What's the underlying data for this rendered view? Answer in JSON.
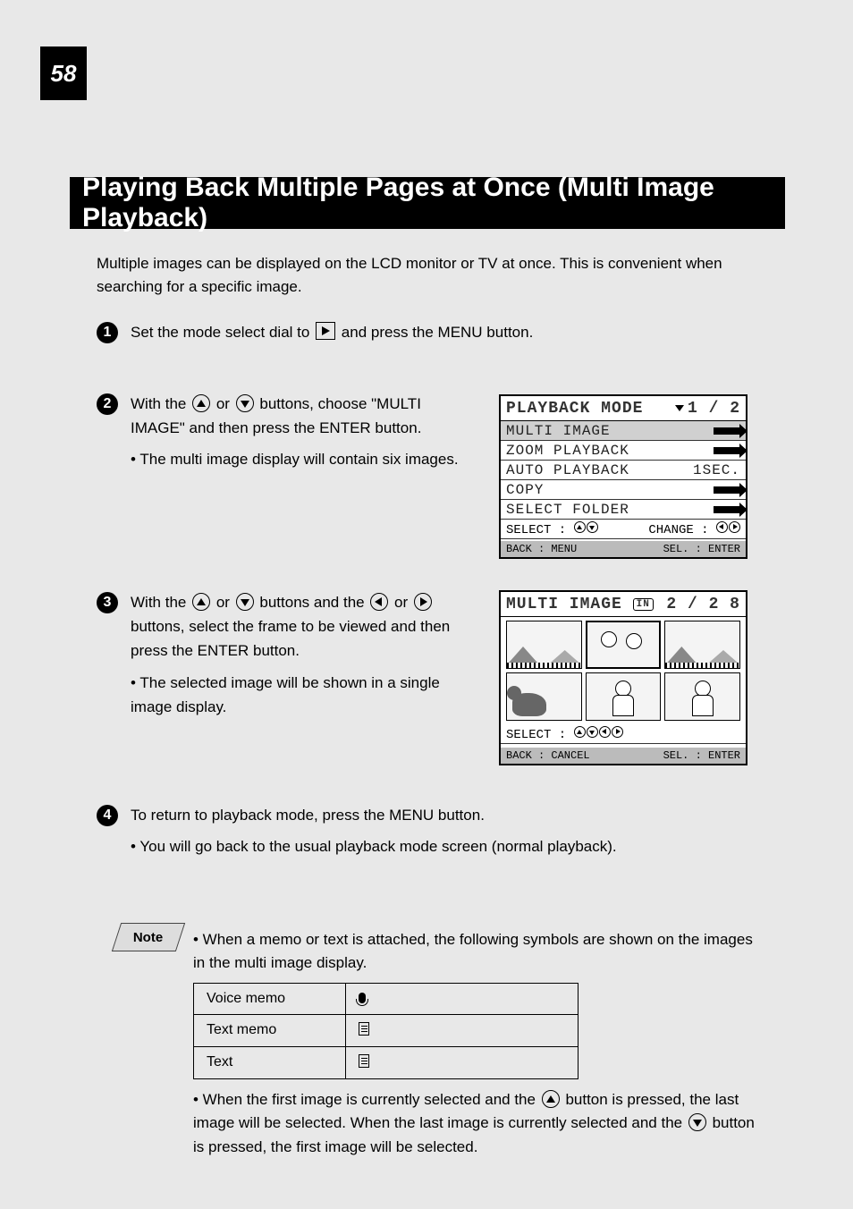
{
  "page_number": "58",
  "section_title": "Playing Back Multiple Pages at Once (Multi Image Playback)",
  "intro": "Multiple images can be displayed on the LCD monitor or TV at once. This is convenient when searching for a specific image.",
  "steps": {
    "s1": {
      "text_before": "Set the mode select dial to ",
      "text_after": " and press the MENU button."
    },
    "s2": {
      "text_before": "With the ",
      "text_middle": " buttons, choose \"MULTI IMAGE\" and then press the ENTER button.",
      "text_tail": "• The multi image display will contain six images."
    },
    "s3": {
      "text_a": "With the ",
      "text_b": " buttons and the ",
      "text_c": " buttons, select the frame to be viewed and then press the ENTER button.",
      "bullet": "• The selected image will be shown in a single image display."
    },
    "s4": {
      "text": "To return to playback mode, press the MENU button.",
      "bullet": "• You will go back to the usual playback mode screen (normal playback)."
    }
  },
  "lcd_menu": {
    "title": "PLAYBACK MODE",
    "page": "1 / 2",
    "rows": {
      "r0": {
        "label": "MULTI IMAGE",
        "value_type": "arrow"
      },
      "r1": {
        "label": "ZOOM PLAYBACK",
        "value_type": "arrow"
      },
      "r2": {
        "label": "AUTO PLAYBACK",
        "value": "1SEC."
      },
      "r3": {
        "label": "COPY",
        "value_type": "arrow"
      },
      "r4": {
        "label": "SELECT FOLDER",
        "value_type": "arrow"
      }
    },
    "nav_select": "SELECT :",
    "nav_change": "CHANGE :",
    "back": "BACK : MENU",
    "sel": "SEL. : ENTER"
  },
  "lcd_multi": {
    "title": "MULTI IMAGE",
    "badge": "IN",
    "page": "2 / 2 8",
    "nav_select": "SELECT :",
    "back": "BACK : CANCEL",
    "sel": "SEL. : ENTER"
  },
  "note": {
    "label": "Note",
    "lead": "• When a memo or text is attached, the following symbols are shown on the images in the multi image display.",
    "table": {
      "r0": {
        "k": "Voice memo",
        "sym_type": "mic"
      },
      "r1": {
        "k": "Text memo",
        "sym_type": "doc"
      },
      "r2": {
        "k": "Text",
        "sym_type": "doc"
      }
    },
    "tail_a": "• When the first image is currently selected and the ",
    "tail_b": " button is pressed, the last image will be selected. When the last image is currently selected and the ",
    "tail_c": " button is pressed, the first image will be selected."
  }
}
